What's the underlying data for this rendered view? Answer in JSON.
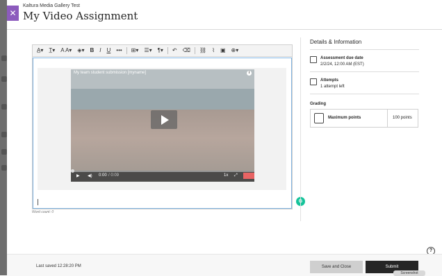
{
  "header": {
    "course_name": "Kaltura Media Gallery Test",
    "title": "My Video Assignment",
    "close_symbol": "✕"
  },
  "toolbar": {
    "items": [
      {
        "name": "font-style-menu",
        "label": "A̲▾"
      },
      {
        "name": "paragraph-style-menu",
        "label": "T̲▾"
      },
      {
        "name": "font-size-menu",
        "label": "A A▾"
      },
      {
        "name": "text-color-menu",
        "label": "◈▾"
      },
      {
        "name": "bold-button",
        "label": "B"
      },
      {
        "name": "italic-button",
        "label": "I"
      },
      {
        "name": "underline-button",
        "label": "U"
      },
      {
        "name": "more-formatting-button",
        "label": "•••"
      },
      {
        "name": "table-menu",
        "label": "⊞▾"
      },
      {
        "name": "align-menu",
        "label": "☰▾"
      },
      {
        "name": "paragraph-menu",
        "label": "¶▾"
      },
      {
        "name": "undo-button",
        "label": "↶"
      },
      {
        "name": "clear-format-button",
        "label": "⌫"
      },
      {
        "name": "link-button",
        "label": "⛓"
      },
      {
        "name": "attach-button",
        "label": "⌇"
      },
      {
        "name": "image-button",
        "label": "▣"
      },
      {
        "name": "insert-content-menu",
        "label": "⊕▾"
      }
    ]
  },
  "video": {
    "title": "My team student submission [myname]",
    "time_current": "0:00",
    "time_total": "/ 0:09",
    "speed": "1x",
    "progress": 0.0
  },
  "editor": {
    "word_count": "Word count: 0"
  },
  "details": {
    "heading": "Details & Information",
    "due_label": "Assessment due date",
    "due_value": "2/2/24, 12:00 AM (EST)",
    "attempts_label": "Attempts",
    "attempts_value": "1 attempt left",
    "grading_label": "Grading",
    "max_points_label": "Maximum points",
    "max_points_value": "100 points"
  },
  "footer": {
    "last_saved": "Last saved 12:28:20 PM",
    "save_close_label": "Save and Close",
    "submit_label": "Submit",
    "screenshot_tag": "Screenshot"
  },
  "colors": {
    "accent_purple": "#8c5bbd",
    "submit_dark": "#262626",
    "grammarly_green": "#15c39a",
    "focus_blue": "#7fb3e0"
  }
}
